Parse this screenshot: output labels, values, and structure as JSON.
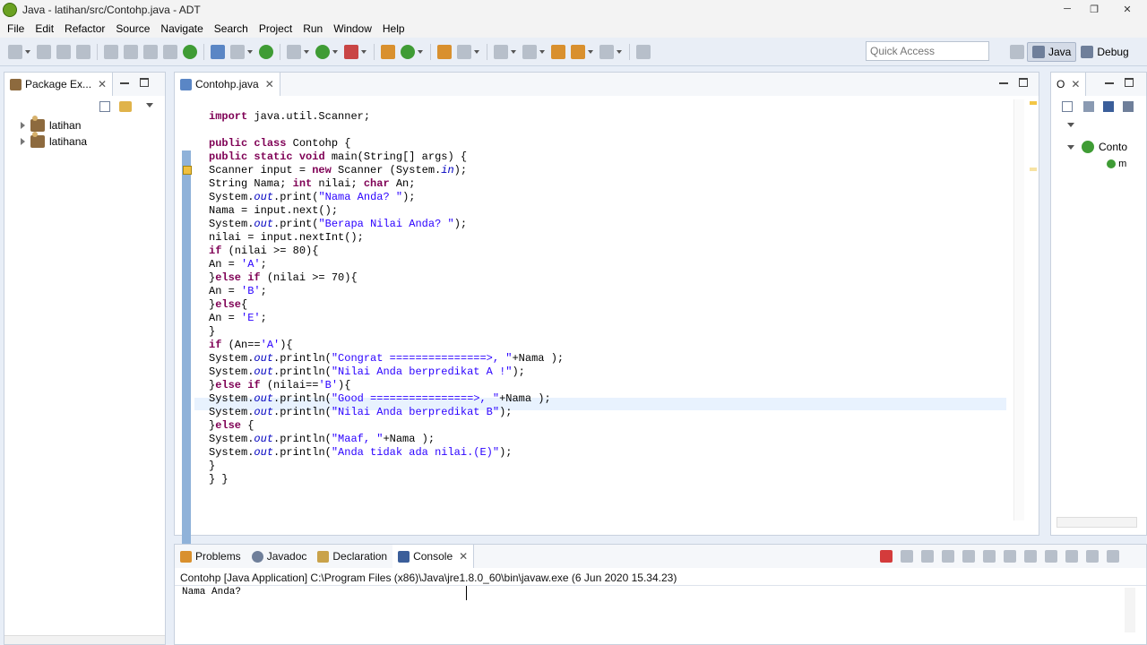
{
  "window": {
    "title": "Java - latihan/src/Contohp.java - ADT",
    "minimize_glyph": "─",
    "restore_glyph": "❐",
    "close_glyph": "✕"
  },
  "menubar": {
    "items": [
      "File",
      "Edit",
      "Refactor",
      "Source",
      "Navigate",
      "Search",
      "Project",
      "Run",
      "Window",
      "Help"
    ]
  },
  "toolbar": {
    "quick_access_placeholder": "Quick Access",
    "perspectives": [
      {
        "label": "Java",
        "active": true
      },
      {
        "label": "Debug",
        "active": false
      }
    ]
  },
  "package_explorer": {
    "tab_label": "Package Ex...",
    "close_glyph": "✕",
    "projects": [
      "latihan",
      "latihana"
    ]
  },
  "editor": {
    "tab_label": "Contohp.java",
    "close_glyph": "✕",
    "code_lines": [
      "import java.util.Scanner;",
      "",
      "public class Contohp {",
      "public static void main(String[] args) {",
      "Scanner input = new Scanner (System.in);",
      "String Nama; int nilai; char An;",
      "System.out.print(\"Nama Anda? \");",
      "Nama = input.next();",
      "System.out.print(\"Berapa Nilai Anda? \");",
      "nilai = input.nextInt();",
      "if (nilai >= 80){",
      "An = 'A';",
      "}else if (nilai >= 70){",
      "An = 'B';",
      "}else{",
      "An = 'E';",
      "}",
      "if (An=='A'){",
      "System.out.println(\"Congrat ===============>, \"+Nama );",
      "System.out.println(\"Nilai Anda berpredikat A !\");",
      "}else if (nilai=='B'){",
      "System.out.println(\"Good ================>, \"+Nama );",
      "System.out.println(\"Nilai Anda berpredikat B\");",
      "}else {",
      "System.out.println(\"Maaf, \"+Nama );",
      "System.out.println(\"Anda tidak ada nilai.(E)\");",
      "}",
      "} }"
    ]
  },
  "outline": {
    "tab_label": "O",
    "close_glyph": "✕",
    "class_label": "Conto",
    "method_label": "m"
  },
  "bottom_panel": {
    "tabs": [
      {
        "label": "Problems",
        "active": false
      },
      {
        "label": "Javadoc",
        "active": false
      },
      {
        "label": "Declaration",
        "active": false
      },
      {
        "label": "Console",
        "active": true
      }
    ],
    "close_glyph": "✕",
    "console_header": "Contohp [Java Application] C:\\Program Files (x86)\\Java\\jre1.8.0_60\\bin\\javaw.exe (6 Jun 2020 15.34.23)",
    "console_output": "Nama Anda?"
  },
  "colors": {
    "keyword": "#7f0055",
    "string": "#2a00ff",
    "field": "#0000c0",
    "change_ruler": "#8fb2d9",
    "current_line": "#e8f2fe"
  }
}
